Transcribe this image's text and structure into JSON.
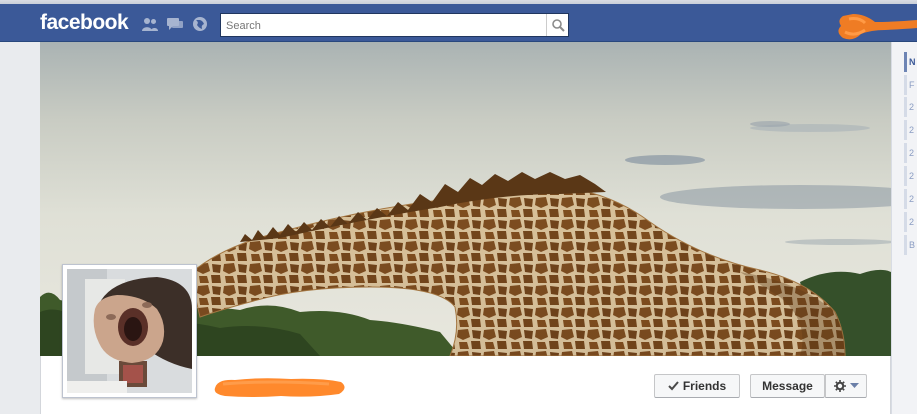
{
  "header": {
    "logo": "facebook",
    "search": {
      "placeholder": "Search",
      "value": ""
    },
    "icons": [
      "friend-requests-icon",
      "messages-icon",
      "notifications-globe-icon",
      "search-icon"
    ]
  },
  "profile": {
    "friends_button": "Friends",
    "message_button": "Message",
    "settings_icon": "gear-icon",
    "dropdown_icon": "caret-down-icon",
    "check_icon": "check-icon"
  },
  "timeline_nav": {
    "items": [
      "N",
      "F",
      "2",
      "2",
      "2",
      "2",
      "2",
      "2",
      "B"
    ]
  },
  "colors": {
    "brand": "#3b5998",
    "redaction": "#ff7f1a"
  }
}
